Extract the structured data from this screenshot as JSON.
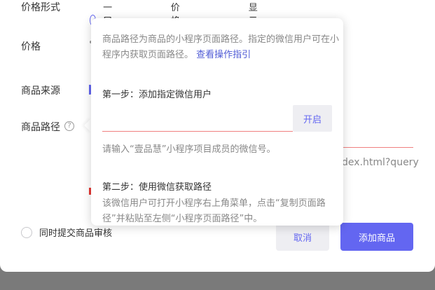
{
  "form": {
    "price_form_label": "价格形式",
    "price_form_options": [
      "一口价",
      "价格区间",
      "显示折扣价"
    ],
    "price_label": "价格",
    "source_label": "商品来源",
    "path_label": "商品路径",
    "path_hint_partial": "dex.html?query",
    "help_icon_glyph": "?",
    "audit_label": "同时提交商品审核"
  },
  "popover": {
    "intro_text": "商品路径为商品的小程序页面路径。指定的微信用户可在小程序内获取页面路径。",
    "guide_link": "查看操作指引",
    "step1_title": "第一步：添加指定微信用户",
    "user_input_value": "",
    "open_button": "开启",
    "input_tip": "请输入“壹品慧”小程序项目成员的微信号。",
    "step2_title": "第二步：使用微信获取路径",
    "step2_text": "该微信用户可打开小程序右上角菜单，点击“复制页面路径”并粘贴至左侧“小程序页面路径”中。"
  },
  "actions": {
    "cancel": "取消",
    "add_product": "添加商品"
  },
  "colors": {
    "accent": "#6366f1",
    "error": "#f08080",
    "link": "#4f5bd5"
  }
}
